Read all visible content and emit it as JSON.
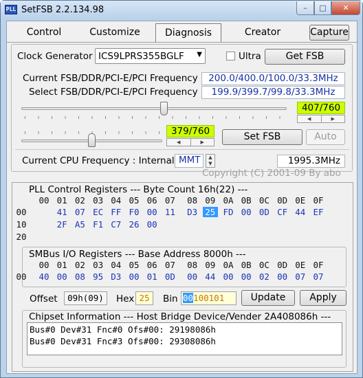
{
  "window": {
    "title": "SetFSB 2.2.134.98",
    "app_icon_text": "PLL",
    "min_glyph": "–",
    "max_glyph": "□",
    "close_glyph": "✕"
  },
  "tabs": [
    {
      "label": "Control",
      "selected": false
    },
    {
      "label": "Customize",
      "selected": false
    },
    {
      "label": "Diagnosis",
      "selected": true
    },
    {
      "label": "Creator",
      "selected": false
    },
    {
      "label": "Capture",
      "selected": false
    }
  ],
  "clock_generator": {
    "label": "Clock Generator",
    "value": "ICS9LPRS355BGLF",
    "ultra_label": "Ultra",
    "ultra_checked": false,
    "get_fsb_label": "Get FSB"
  },
  "freq": {
    "current_label": "Current FSB/DDR/PCI-E/PCI Frequency",
    "current_value": "200.0/400.0/100.0/33.3MHz",
    "select_label": "Select FSB/DDR/PCI-E/PCI Frequency",
    "select_value": "199.9/399.7/99.8/33.3MHz"
  },
  "slider1": {
    "value": "407/760",
    "level": 0.535
  },
  "slider2": {
    "value": "379/760",
    "level": 0.499
  },
  "buttons": {
    "set_fsb": "Set FSB",
    "auto": "Auto"
  },
  "cpu": {
    "label": "Current CPU Frequency : Internal",
    "mode": "MMT",
    "value": "1995.3MHz"
  },
  "copyright": "Copyright (C) 2001-09 By abo",
  "pll": {
    "title": "PLL Control Registers  --- Byte Count 16h(22) ---",
    "headers": [
      "00",
      "01",
      "02",
      "03",
      "04",
      "05",
      "06",
      "07",
      "08",
      "09",
      "0A",
      "0B",
      "0C",
      "0D",
      "0E",
      "0F"
    ],
    "rows": [
      {
        "addr": "00",
        "bytes": [
          "41",
          "07",
          "EC",
          "FF",
          "F0",
          "00",
          "11",
          "D3",
          "25",
          "FD",
          "00",
          "0D",
          "CF",
          "44",
          "EF"
        ]
      },
      {
        "addr": "10",
        "bytes": [
          "2F",
          "A5",
          "F1",
          "C7",
          "26",
          "00"
        ]
      },
      {
        "addr": "20",
        "bytes": []
      }
    ],
    "selected_byte": "25"
  },
  "smbus": {
    "title": "SMBus I/O Registers  --- Base Address 8000h ---",
    "headers": [
      "00",
      "01",
      "02",
      "03",
      "04",
      "05",
      "06",
      "07",
      "08",
      "09",
      "0A",
      "0B",
      "0C",
      "0D",
      "0E",
      "0F"
    ],
    "row": {
      "addr": "00",
      "bytes": [
        "40",
        "00",
        "08",
        "95",
        "D3",
        "00",
        "01",
        "0D",
        "00",
        "44",
        "00",
        "00",
        "02",
        "00",
        "07",
        "07"
      ]
    }
  },
  "offset": {
    "label": "Offset",
    "value": "09h(09)",
    "hex_label": "Hex",
    "hex_value": "25",
    "bin_label": "Bin",
    "bin_prefix": "00",
    "bin_rest": "100101",
    "update": "Update",
    "apply": "Apply"
  },
  "chipset": {
    "title": "Chipset Information  --- Host Bridge Device/Vender 2A408086h ---",
    "lines": [
      "Bus#0 Dev#31 Fnc#0 Ofs#00: 29198086h",
      "Bus#0 Dev#31 Fnc#3 Ofs#00: 29308086h"
    ]
  },
  "colors": {
    "value_highlight": "#ccff00",
    "selection": "#3399ff",
    "value_text": "#1a33b5"
  }
}
